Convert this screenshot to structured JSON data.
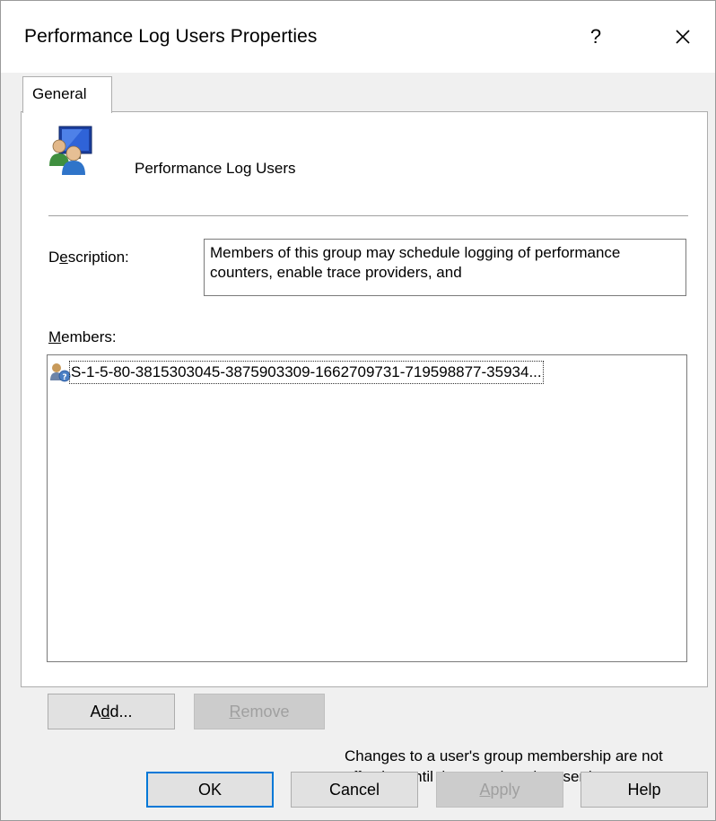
{
  "window": {
    "title": "Performance Log Users Properties",
    "help_glyph": "?",
    "close_icon": "close-icon"
  },
  "tabs": [
    {
      "label": "General",
      "selected": true
    }
  ],
  "group": {
    "name": "Performance Log Users",
    "icon": "group-users-icon"
  },
  "description": {
    "label": "Description:",
    "access_key": "e",
    "text": "Members of this group may schedule logging of performance counters, enable trace providers, and"
  },
  "members": {
    "label": "Members:",
    "access_key": "M",
    "items": [
      {
        "icon": "unknown-user-icon",
        "text": "S-1-5-80-3815303045-3875903309-1662709731-719598877-35934..."
      }
    ]
  },
  "buttons": {
    "add": "Add...",
    "remove": "Remove",
    "ok": "OK",
    "cancel": "Cancel",
    "apply": "Apply",
    "help": "Help"
  },
  "note": "Changes to a user's group membership are not effective until the next time the user logs on.",
  "colors": {
    "accent": "#0078d7",
    "dialog_bg": "#f0f0f0",
    "disabled_text": "#a0a0a0"
  }
}
